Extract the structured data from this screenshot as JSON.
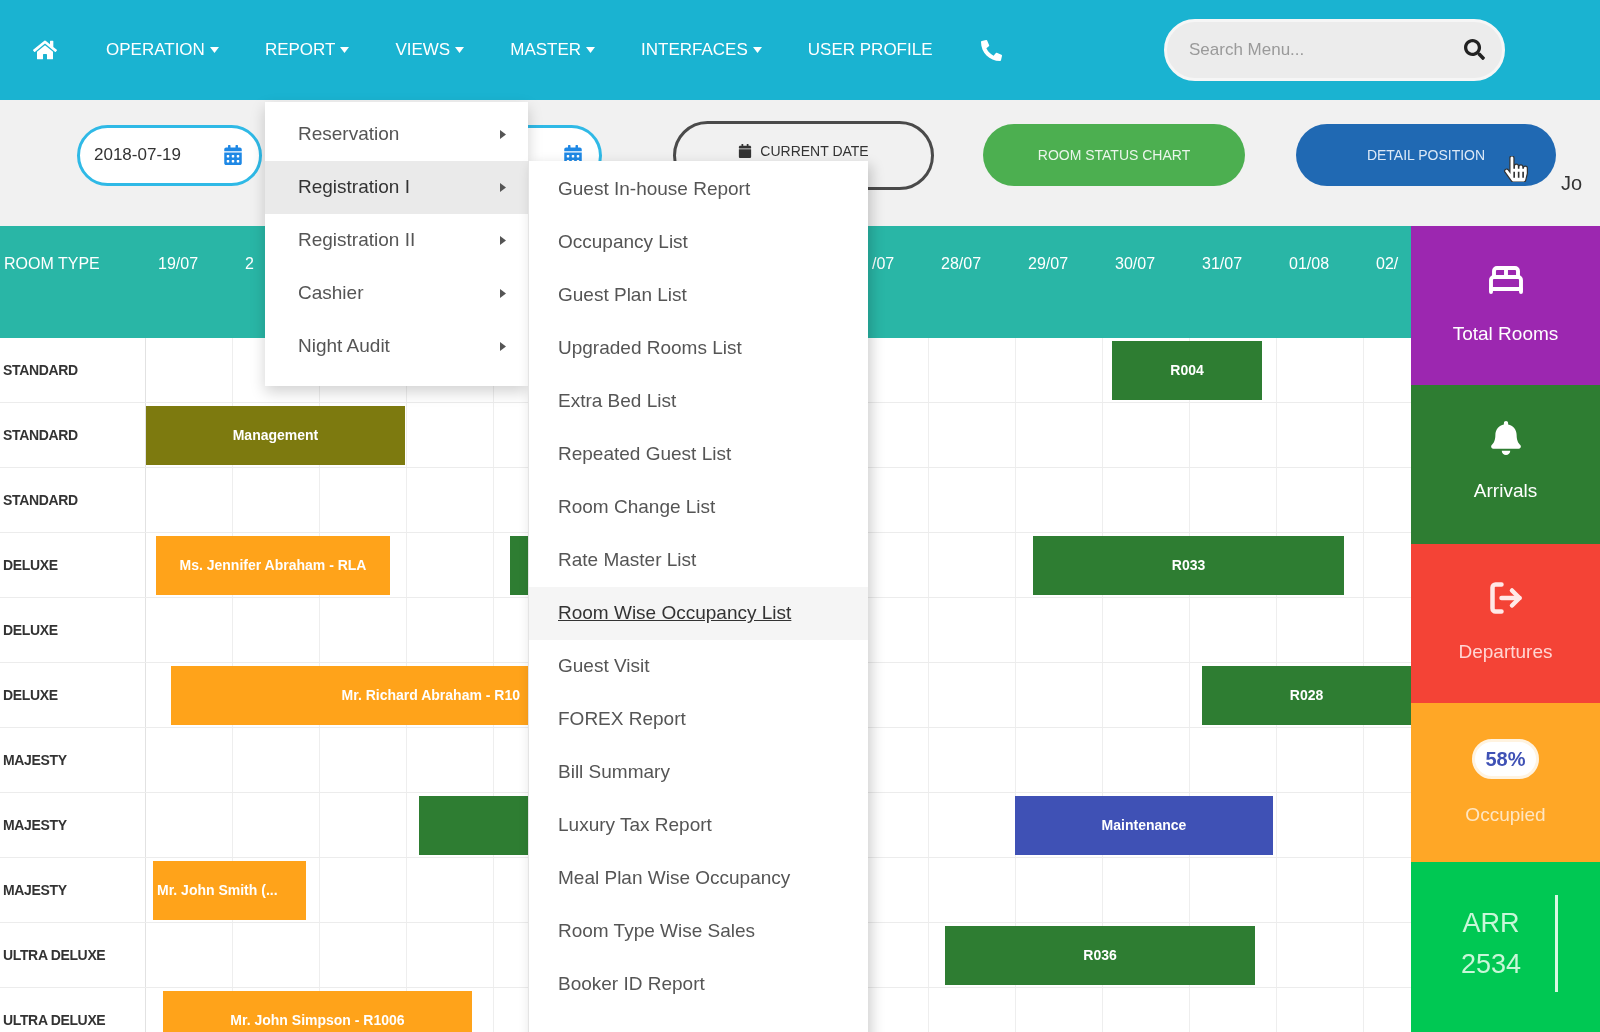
{
  "nav": {
    "items": [
      {
        "label": "OPERATION",
        "dropdown": true
      },
      {
        "label": "REPORT",
        "dropdown": true
      },
      {
        "label": "VIEWS",
        "dropdown": true
      },
      {
        "label": "MASTER",
        "dropdown": true
      },
      {
        "label": "INTERFACES",
        "dropdown": true
      },
      {
        "label": "USER PROFILE",
        "dropdown": false
      }
    ],
    "search": {
      "placeholder": "Search Menu..."
    }
  },
  "toolbar": {
    "date_field": {
      "value": "2018-07-19"
    },
    "buttons": [
      {
        "label": "CURRENT DATE",
        "kind": "outline"
      },
      {
        "label": "ROOM STATUS CHART",
        "kind": "success"
      },
      {
        "label": "DETAIL POSITION",
        "kind": "primary"
      }
    ],
    "user_name": "Jo"
  },
  "chart": {
    "room_type_heading": "ROOM TYPE",
    "dates": [
      "19/07",
      "2",
      "/07",
      "28/07",
      "29/07",
      "30/07",
      "31/07",
      "01/08",
      "02/"
    ],
    "rows": [
      {
        "room_type": "STANDARD",
        "bookings": [
          {
            "label": "R004",
            "color": "#2e7d32"
          }
        ]
      },
      {
        "room_type": "STANDARD",
        "bookings": [
          {
            "label": "Management",
            "color": "#7d7a0f"
          }
        ]
      },
      {
        "room_type": "STANDARD"
      },
      {
        "room_type": "DELUXE",
        "bookings": [
          {
            "label": "Ms. Jennifer Abraham - RLA",
            "color": "#ffa31a"
          },
          {
            "color": "#2e7d32"
          },
          {
            "label": "R033",
            "color": "#2e7d32"
          }
        ]
      },
      {
        "room_type": "DELUXE"
      },
      {
        "room_type": "DELUXE",
        "bookings": [
          {
            "label": "Mr. Richard Abraham - R10",
            "color": "#ffa31a"
          },
          {
            "label": "R028",
            "color": "#2e7d32"
          }
        ]
      },
      {
        "room_type": "MAJESTY"
      },
      {
        "room_type": "MAJESTY",
        "bookings": [
          {
            "color": "#2e7d32"
          },
          {
            "label": "Maintenance",
            "color": "#3f51b5"
          }
        ]
      },
      {
        "room_type": "MAJESTY",
        "bookings": [
          {
            "label": "Mr. John Smith (...",
            "color": "#ffa31a"
          }
        ]
      },
      {
        "room_type": "ULTRA DELUXE",
        "bookings": [
          {
            "label": "R036",
            "color": "#2e7d32"
          }
        ]
      },
      {
        "room_type": "ULTRA DELUXE",
        "bookings": [
          {
            "label": "Mr. John Simpson - R1006",
            "color": "#ffa31a"
          }
        ]
      }
    ]
  },
  "summary_cards": [
    {
      "kind": "total_rooms",
      "label": "Total Rooms",
      "color": "#9c27b0"
    },
    {
      "kind": "arrivals",
      "label": "Arrivals",
      "color": "#2e7d32"
    },
    {
      "kind": "departures",
      "label": "Departures",
      "color": "#f44336"
    },
    {
      "kind": "occupied",
      "badge": "58%",
      "label": "Occupied",
      "color": "#ffa726"
    },
    {
      "kind": "arr",
      "label": "ARR",
      "value": "2534",
      "color": "#00c853"
    }
  ],
  "report_menu": {
    "items": [
      {
        "label": "Reservation",
        "selected": false,
        "has_submenu": true
      },
      {
        "label": "Registration I",
        "selected": true,
        "has_submenu": true
      },
      {
        "label": "Registration II",
        "selected": false,
        "has_submenu": true
      },
      {
        "label": "Cashier",
        "selected": false,
        "has_submenu": true
      },
      {
        "label": "Night Audit",
        "selected": false,
        "has_submenu": true
      }
    ],
    "submenu": {
      "items": [
        {
          "label": "Guest In-house Report",
          "selected": false
        },
        {
          "label": "Occupancy List",
          "selected": false
        },
        {
          "label": "Guest Plan List",
          "selected": false
        },
        {
          "label": "Upgraded Rooms List",
          "selected": false
        },
        {
          "label": "Extra Bed List",
          "selected": false
        },
        {
          "label": "Repeated Guest List",
          "selected": false
        },
        {
          "label": "Room Change List",
          "selected": false
        },
        {
          "label": "Rate Master List",
          "selected": false
        },
        {
          "label": "Room Wise Occupancy List",
          "selected": true
        },
        {
          "label": "Guest Visit",
          "selected": false
        },
        {
          "label": "FOREX Report",
          "selected": false
        },
        {
          "label": "Bill Summary",
          "selected": false
        },
        {
          "label": "Luxury Tax Report",
          "selected": false
        },
        {
          "label": "Meal Plan Wise Occupancy",
          "selected": false
        },
        {
          "label": "Room Type Wise Sales",
          "selected": false
        },
        {
          "label": "Booker ID Report",
          "selected": false
        }
      ]
    }
  }
}
